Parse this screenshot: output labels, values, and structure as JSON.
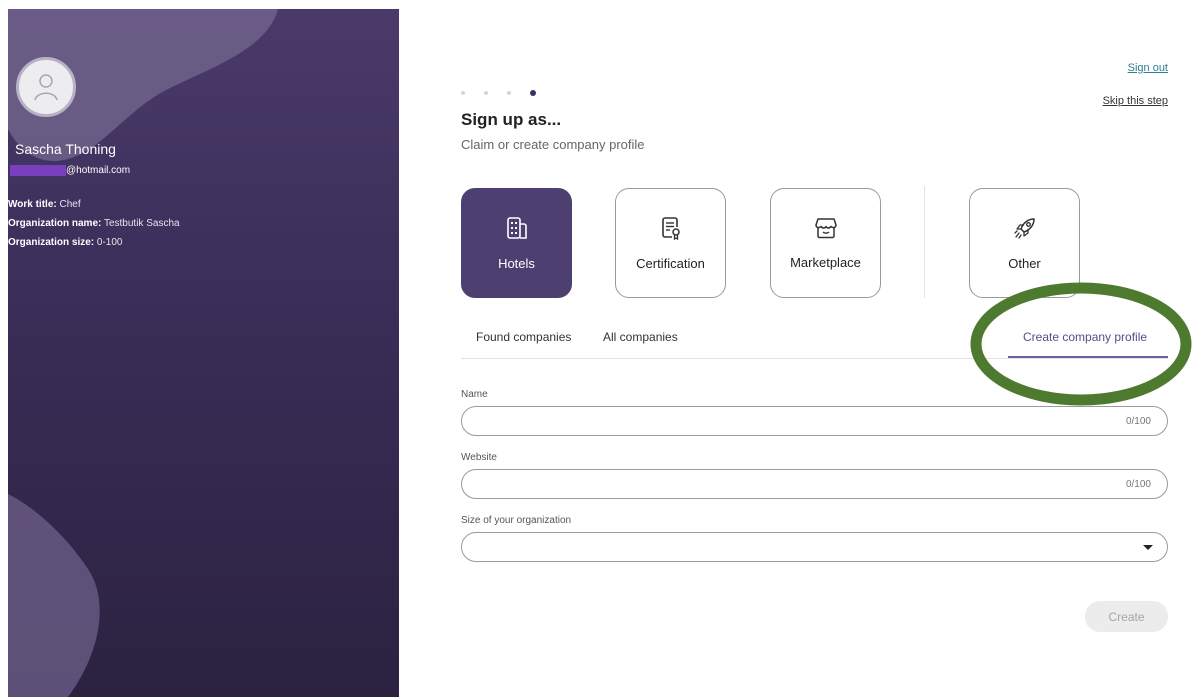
{
  "sidebar": {
    "user_name": "Sascha Thoning",
    "email_suffix": "@hotmail.com",
    "work_title_label": "Work title:",
    "work_title_value": "Chef",
    "org_name_label": "Organization name:",
    "org_name_value": "Testbutik Sascha",
    "org_size_label": "Organization size:",
    "org_size_value": "0-100"
  },
  "header": {
    "sign_out": "Sign out",
    "skip": "Skip this step",
    "step_count": 4,
    "current_step": 4
  },
  "main": {
    "title": "Sign up as...",
    "subtitle": "Claim or create company profile",
    "cards": [
      {
        "label": "Hotels",
        "icon": "building-icon",
        "selected": true
      },
      {
        "label": "Certification",
        "icon": "certificate-icon",
        "selected": false
      },
      {
        "label": "Marketplace",
        "icon": "storefront-icon",
        "selected": false
      },
      {
        "label": "Other",
        "icon": "rocket-icon",
        "selected": false
      }
    ],
    "tabs": [
      {
        "label": "Found companies",
        "active": false
      },
      {
        "label": "All companies",
        "active": false
      },
      {
        "label": "Create company profile",
        "active": true
      }
    ]
  },
  "form": {
    "name_label": "Name",
    "name_counter": "0/100",
    "website_label": "Website",
    "website_counter": "0/100",
    "size_label": "Size of your organization",
    "create_label": "Create"
  },
  "colors": {
    "accent": "#4d4070",
    "sidebar_top": "#4a3a6b",
    "highlight": "#4e7a2f"
  }
}
